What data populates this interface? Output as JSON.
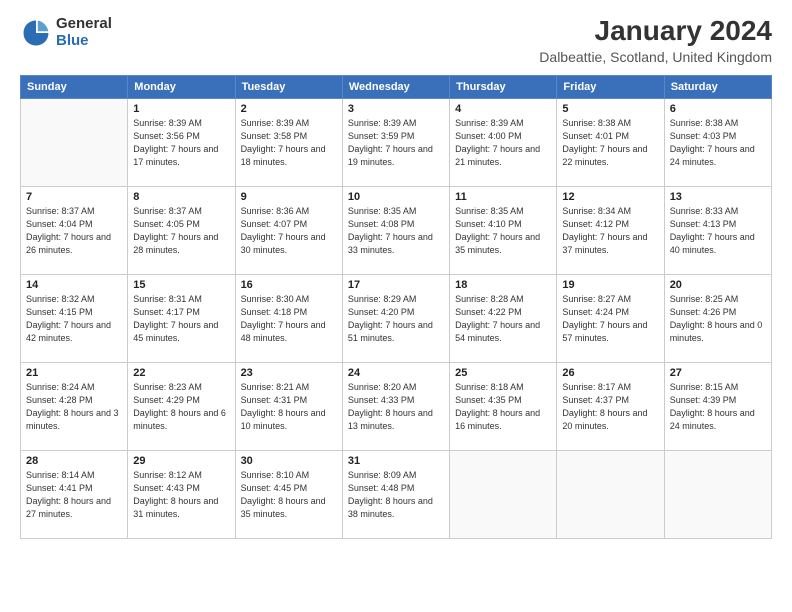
{
  "header": {
    "logo": {
      "general": "General",
      "blue": "Blue"
    },
    "title": "January 2024",
    "location": "Dalbeattie, Scotland, United Kingdom"
  },
  "calendar": {
    "days_of_week": [
      "Sunday",
      "Monday",
      "Tuesday",
      "Wednesday",
      "Thursday",
      "Friday",
      "Saturday"
    ],
    "weeks": [
      [
        {
          "day": "",
          "info": ""
        },
        {
          "day": "1",
          "info": "Sunrise: 8:39 AM\nSunset: 3:56 PM\nDaylight: 7 hours\nand 17 minutes."
        },
        {
          "day": "2",
          "info": "Sunrise: 8:39 AM\nSunset: 3:58 PM\nDaylight: 7 hours\nand 18 minutes."
        },
        {
          "day": "3",
          "info": "Sunrise: 8:39 AM\nSunset: 3:59 PM\nDaylight: 7 hours\nand 19 minutes."
        },
        {
          "day": "4",
          "info": "Sunrise: 8:39 AM\nSunset: 4:00 PM\nDaylight: 7 hours\nand 21 minutes."
        },
        {
          "day": "5",
          "info": "Sunrise: 8:38 AM\nSunset: 4:01 PM\nDaylight: 7 hours\nand 22 minutes."
        },
        {
          "day": "6",
          "info": "Sunrise: 8:38 AM\nSunset: 4:03 PM\nDaylight: 7 hours\nand 24 minutes."
        }
      ],
      [
        {
          "day": "7",
          "info": "Sunrise: 8:37 AM\nSunset: 4:04 PM\nDaylight: 7 hours\nand 26 minutes."
        },
        {
          "day": "8",
          "info": "Sunrise: 8:37 AM\nSunset: 4:05 PM\nDaylight: 7 hours\nand 28 minutes."
        },
        {
          "day": "9",
          "info": "Sunrise: 8:36 AM\nSunset: 4:07 PM\nDaylight: 7 hours\nand 30 minutes."
        },
        {
          "day": "10",
          "info": "Sunrise: 8:35 AM\nSunset: 4:08 PM\nDaylight: 7 hours\nand 33 minutes."
        },
        {
          "day": "11",
          "info": "Sunrise: 8:35 AM\nSunset: 4:10 PM\nDaylight: 7 hours\nand 35 minutes."
        },
        {
          "day": "12",
          "info": "Sunrise: 8:34 AM\nSunset: 4:12 PM\nDaylight: 7 hours\nand 37 minutes."
        },
        {
          "day": "13",
          "info": "Sunrise: 8:33 AM\nSunset: 4:13 PM\nDaylight: 7 hours\nand 40 minutes."
        }
      ],
      [
        {
          "day": "14",
          "info": "Sunrise: 8:32 AM\nSunset: 4:15 PM\nDaylight: 7 hours\nand 42 minutes."
        },
        {
          "day": "15",
          "info": "Sunrise: 8:31 AM\nSunset: 4:17 PM\nDaylight: 7 hours\nand 45 minutes."
        },
        {
          "day": "16",
          "info": "Sunrise: 8:30 AM\nSunset: 4:18 PM\nDaylight: 7 hours\nand 48 minutes."
        },
        {
          "day": "17",
          "info": "Sunrise: 8:29 AM\nSunset: 4:20 PM\nDaylight: 7 hours\nand 51 minutes."
        },
        {
          "day": "18",
          "info": "Sunrise: 8:28 AM\nSunset: 4:22 PM\nDaylight: 7 hours\nand 54 minutes."
        },
        {
          "day": "19",
          "info": "Sunrise: 8:27 AM\nSunset: 4:24 PM\nDaylight: 7 hours\nand 57 minutes."
        },
        {
          "day": "20",
          "info": "Sunrise: 8:25 AM\nSunset: 4:26 PM\nDaylight: 8 hours\nand 0 minutes."
        }
      ],
      [
        {
          "day": "21",
          "info": "Sunrise: 8:24 AM\nSunset: 4:28 PM\nDaylight: 8 hours\nand 3 minutes."
        },
        {
          "day": "22",
          "info": "Sunrise: 8:23 AM\nSunset: 4:29 PM\nDaylight: 8 hours\nand 6 minutes."
        },
        {
          "day": "23",
          "info": "Sunrise: 8:21 AM\nSunset: 4:31 PM\nDaylight: 8 hours\nand 10 minutes."
        },
        {
          "day": "24",
          "info": "Sunrise: 8:20 AM\nSunset: 4:33 PM\nDaylight: 8 hours\nand 13 minutes."
        },
        {
          "day": "25",
          "info": "Sunrise: 8:18 AM\nSunset: 4:35 PM\nDaylight: 8 hours\nand 16 minutes."
        },
        {
          "day": "26",
          "info": "Sunrise: 8:17 AM\nSunset: 4:37 PM\nDaylight: 8 hours\nand 20 minutes."
        },
        {
          "day": "27",
          "info": "Sunrise: 8:15 AM\nSunset: 4:39 PM\nDaylight: 8 hours\nand 24 minutes."
        }
      ],
      [
        {
          "day": "28",
          "info": "Sunrise: 8:14 AM\nSunset: 4:41 PM\nDaylight: 8 hours\nand 27 minutes."
        },
        {
          "day": "29",
          "info": "Sunrise: 8:12 AM\nSunset: 4:43 PM\nDaylight: 8 hours\nand 31 minutes."
        },
        {
          "day": "30",
          "info": "Sunrise: 8:10 AM\nSunset: 4:45 PM\nDaylight: 8 hours\nand 35 minutes."
        },
        {
          "day": "31",
          "info": "Sunrise: 8:09 AM\nSunset: 4:48 PM\nDaylight: 8 hours\nand 38 minutes."
        },
        {
          "day": "",
          "info": ""
        },
        {
          "day": "",
          "info": ""
        },
        {
          "day": "",
          "info": ""
        }
      ]
    ]
  }
}
